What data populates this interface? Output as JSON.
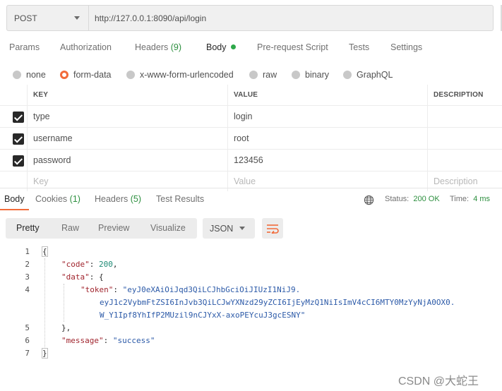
{
  "request": {
    "method": "POST",
    "url": "http://127.0.0.1:8090/api/login"
  },
  "request_tabs": [
    {
      "label": "Params"
    },
    {
      "label": "Authorization"
    },
    {
      "label": "Headers",
      "count": "(9)"
    },
    {
      "label": "Body"
    },
    {
      "label": "Pre-request Script"
    },
    {
      "label": "Tests"
    },
    {
      "label": "Settings"
    }
  ],
  "body_types": [
    {
      "label": "none",
      "selected": false
    },
    {
      "label": "form-data",
      "selected": true
    },
    {
      "label": "x-www-form-urlencoded",
      "selected": false
    },
    {
      "label": "raw",
      "selected": false
    },
    {
      "label": "binary",
      "selected": false
    },
    {
      "label": "GraphQL",
      "selected": false
    }
  ],
  "params_table": {
    "headers": {
      "key": "KEY",
      "value": "VALUE",
      "description": "DESCRIPTION"
    },
    "rows": [
      {
        "key": "type",
        "value": "login",
        "checked": true
      },
      {
        "key": "username",
        "value": "root",
        "checked": true
      },
      {
        "key": "password",
        "value": "123456",
        "checked": true
      }
    ],
    "placeholders": {
      "key": "Key",
      "value": "Value",
      "description": "Description"
    }
  },
  "response_tabs": [
    {
      "label": "Body"
    },
    {
      "label": "Cookies",
      "count": "(1)"
    },
    {
      "label": "Headers",
      "count": "(5)"
    },
    {
      "label": "Test Results"
    }
  ],
  "response_meta": {
    "status_label": "Status:",
    "status_value": "200 OK",
    "time_label": "Time:",
    "time_value": "4 ms"
  },
  "view_buttons": [
    "Pretty",
    "Raw",
    "Preview",
    "Visualize"
  ],
  "format": "JSON",
  "code": {
    "line_numbers": [
      "1",
      "2",
      "3",
      "4",
      "5",
      "6",
      "7"
    ],
    "open_brace": "{",
    "close_brace": "}",
    "code_key": "\"code\"",
    "code_value": "200",
    "data_key": "\"data\"",
    "token_key": "\"token\"",
    "token_line1": "\"eyJ0eXAiOiJqd3QiLCJhbGciOiJIUzI1NiJ9.",
    "token_line2": "eyJ1c2VybmFtZSI6InJvb3QiLCJwYXNzd29yZCI6IjEyMzQ1NiIsImV4cCI6MTY0MzYyNjA0OX0.",
    "token_line3": "W_Y1Ipf8YhIfP2MUzil9nCJYxX-axoPEYcuJ3gcESNY\"",
    "data_close": "},",
    "message_key": "\"message\"",
    "message_value": "\"success\""
  },
  "watermark": "CSDN @大蛇王",
  "colors": {
    "accent": "#f26b3a",
    "status_green": "#2d8f3f",
    "json_key": "#a1262f",
    "json_string": "#2c5aa8",
    "json_number": "#1e8a75"
  }
}
